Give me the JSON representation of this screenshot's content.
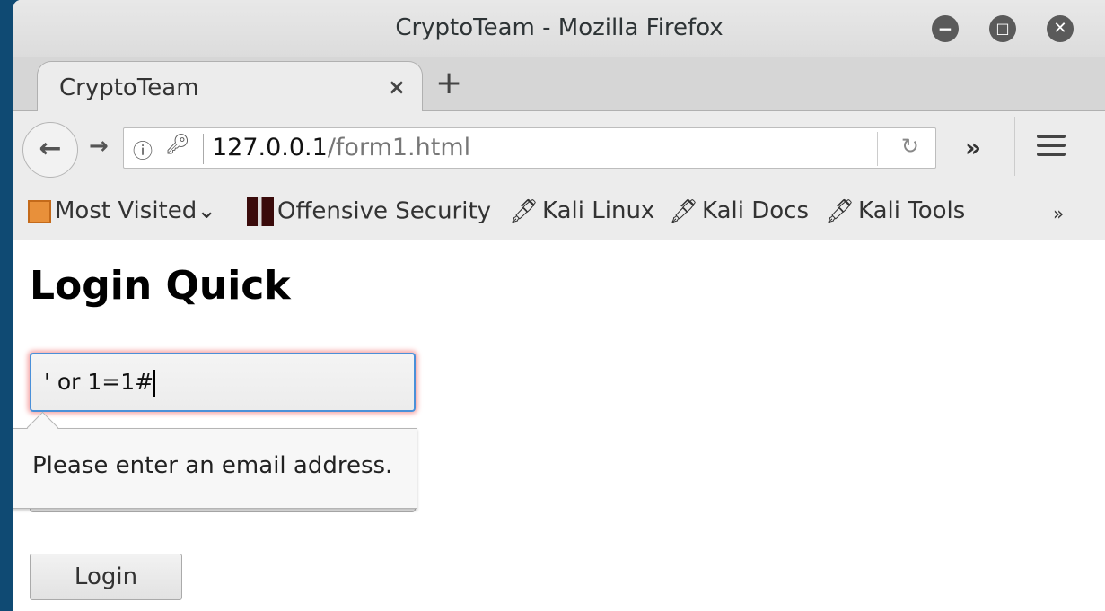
{
  "window": {
    "title": "CryptoTeam - Mozilla Firefox"
  },
  "tab": {
    "label": "CryptoTeam",
    "close": "×",
    "new": "+"
  },
  "nav": {
    "url_host": "127.0.0.1",
    "url_path": "/form1.html",
    "overflow": "»"
  },
  "bookmarks": [
    {
      "label": "Most Visited",
      "icon": "folder-icon"
    },
    {
      "label": "Offensive Security",
      "icon": "offsec-icon"
    },
    {
      "label": "Kali Linux",
      "icon": "kali-dragon-icon"
    },
    {
      "label": "Kali Docs",
      "icon": "kali-dragon-icon"
    },
    {
      "label": "Kali Tools",
      "icon": "kali-dragon-icon"
    }
  ],
  "bookmarks_overflow": "»",
  "page": {
    "heading": "Login Quick",
    "email_value": "' or 1=1#",
    "validation_message": "Please enter an email address.",
    "login_label": "Login"
  }
}
